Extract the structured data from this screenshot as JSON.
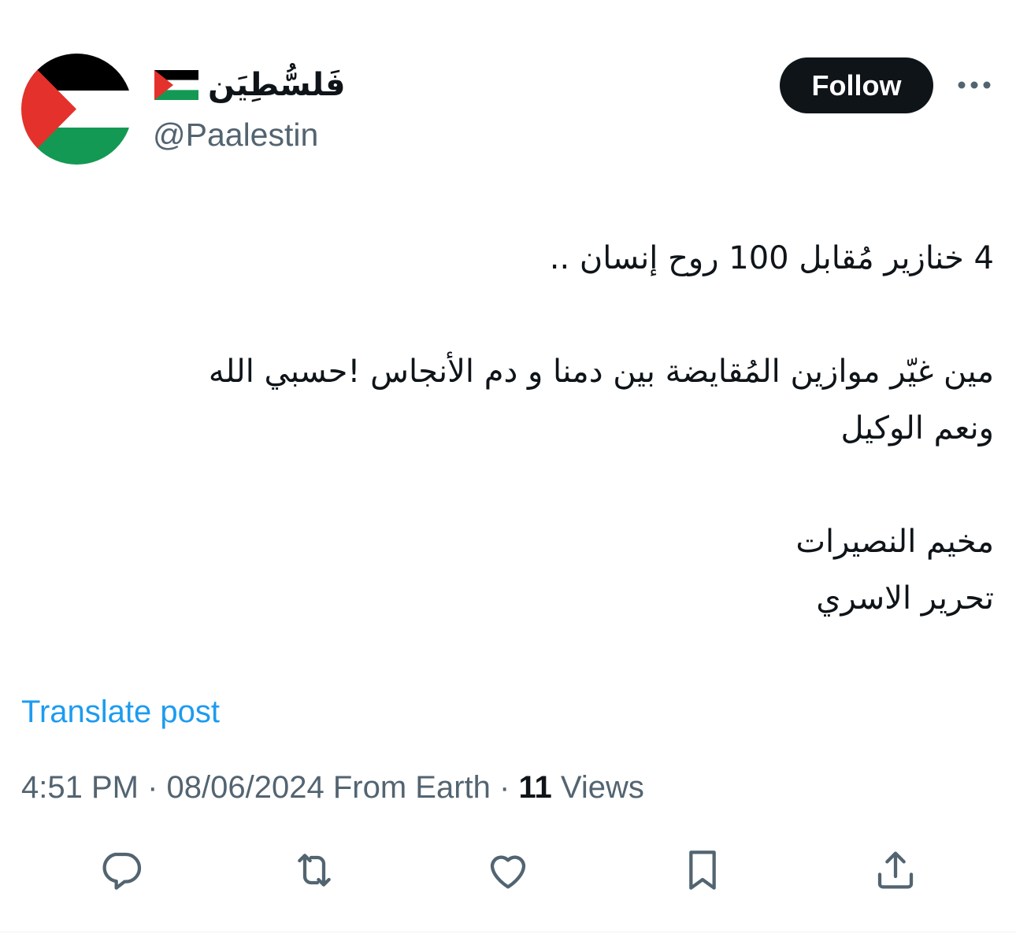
{
  "author": {
    "display_name": "فَلسُّطِيَن",
    "display_name_emoji": "palestine-flag-icon",
    "handle": "@Paalestin",
    "avatar": "palestine-flag-avatar"
  },
  "header": {
    "follow_label": "Follow",
    "more_icon": "more-options-icon"
  },
  "tweet": {
    "lines": [
      "4 خنازير مُقابل 100 روح إنسان ..",
      "",
      "مين غيّر موازين المُقايضة بين دمنا و دم الأنجاس !حسبي الله",
      "ونعم الوكيل",
      "",
      "مخيم النصيرات",
      "تحرير الاسري"
    ]
  },
  "translate_label": "Translate post",
  "meta": {
    "time": "4:51 PM",
    "separator": "·",
    "date": "08/06/2024",
    "source": "From Earth",
    "views_count": "11",
    "views_label": "Views"
  },
  "actions": [
    {
      "name": "reply",
      "icon": "reply-icon"
    },
    {
      "name": "retweet",
      "icon": "retweet-icon"
    },
    {
      "name": "like",
      "icon": "heart-icon"
    },
    {
      "name": "bookmark",
      "icon": "bookmark-icon"
    },
    {
      "name": "share",
      "icon": "share-icon"
    }
  ],
  "colors": {
    "text_primary": "#0f1419",
    "text_secondary": "#536471",
    "link": "#1d9bf0",
    "flag_black": "#000000",
    "flag_white": "#ffffff",
    "flag_green": "#149954",
    "flag_red": "#e4312b"
  }
}
